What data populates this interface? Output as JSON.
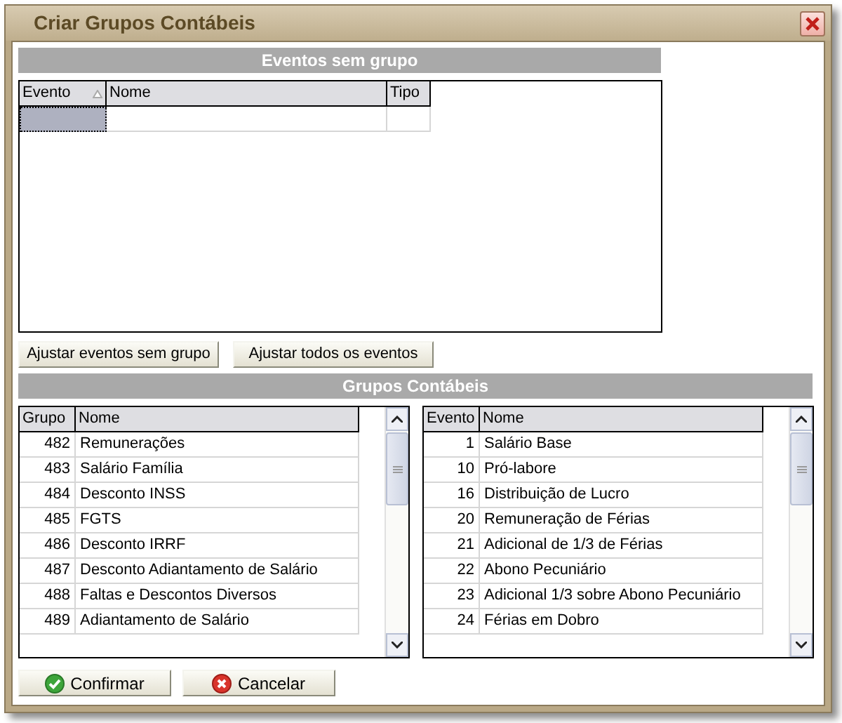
{
  "window": {
    "title": "Criar Grupos Contábeis"
  },
  "events_without_group": {
    "title": "Eventos sem grupo",
    "columns": [
      {
        "label": "Evento",
        "sorted": true
      },
      {
        "label": "Nome",
        "sorted": false
      },
      {
        "label": "Tipo",
        "sorted": false
      }
    ],
    "new_row": {
      "selected": true
    }
  },
  "adjust_buttons": [
    "Ajustar eventos sem grupo",
    "Ajustar todos os eventos"
  ],
  "groups": {
    "title": "Grupos Contábeis",
    "groups_table": {
      "columns": [
        "Grupo",
        "Nome"
      ],
      "rows": [
        {
          "code": "482",
          "name": "Remunerações"
        },
        {
          "code": "483",
          "name": "Salário Família"
        },
        {
          "code": "484",
          "name": "Desconto INSS"
        },
        {
          "code": "485",
          "name": "FGTS"
        },
        {
          "code": "486",
          "name": "Desconto IRRF"
        },
        {
          "code": "487",
          "name": "Desconto Adiantamento de Salário"
        },
        {
          "code": "488",
          "name": "Faltas e Descontos Diversos"
        },
        {
          "code": "489",
          "name": "Adiantamento de Salário"
        }
      ]
    },
    "events_table": {
      "columns": [
        "Evento",
        "Nome"
      ],
      "rows": [
        {
          "code": "1",
          "name": "Salário Base"
        },
        {
          "code": "10",
          "name": "Pró-labore"
        },
        {
          "code": "16",
          "name": "Distribuição de Lucro"
        },
        {
          "code": "20",
          "name": "Remuneração de Férias"
        },
        {
          "code": "21",
          "name": "Adicional de 1/3 de Férias"
        },
        {
          "code": "22",
          "name": "Abono Pecuniário"
        },
        {
          "code": "23",
          "name": "Adicional 1/3 sobre Abono Pecuniário"
        },
        {
          "code": "24",
          "name": "Férias em Dobro"
        }
      ]
    }
  },
  "footer_buttons": [
    {
      "kind": "confirm",
      "label": "Confirmar"
    },
    {
      "kind": "cancel",
      "label": "Cancelar"
    }
  ]
}
